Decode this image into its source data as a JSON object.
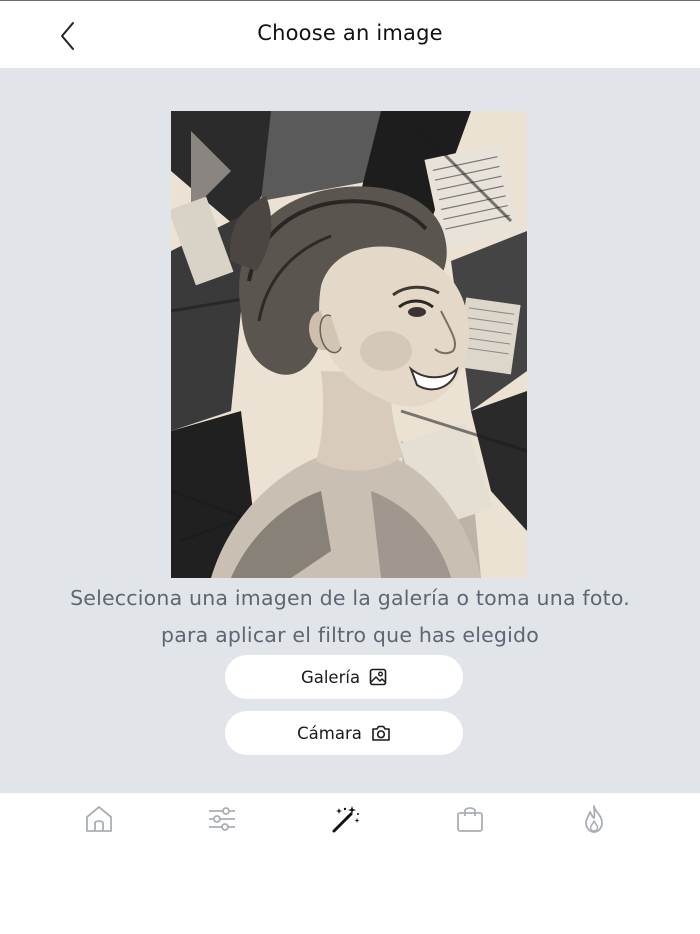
{
  "header": {
    "title": "Choose an image"
  },
  "main": {
    "message_line1": "Selecciona una imagen de la galería o toma una foto.",
    "message_line2": "para aplicar el filtro que has elegido",
    "gallery_label": "Galería",
    "camera_label": "Cámara"
  },
  "bottom_nav": {
    "items": [
      {
        "icon": "home-icon",
        "active": false
      },
      {
        "icon": "sliders-icon",
        "active": false
      },
      {
        "icon": "magic-wand-icon",
        "active": true
      },
      {
        "icon": "shopping-bag-icon",
        "active": false
      },
      {
        "icon": "flame-icon",
        "active": false
      }
    ],
    "active_color": "#111111",
    "inactive_color": "#a9aeb6"
  },
  "colors": {
    "content_background": "#e1e4e8",
    "message_text": "#5d6674",
    "button_background": "#ffffff"
  }
}
